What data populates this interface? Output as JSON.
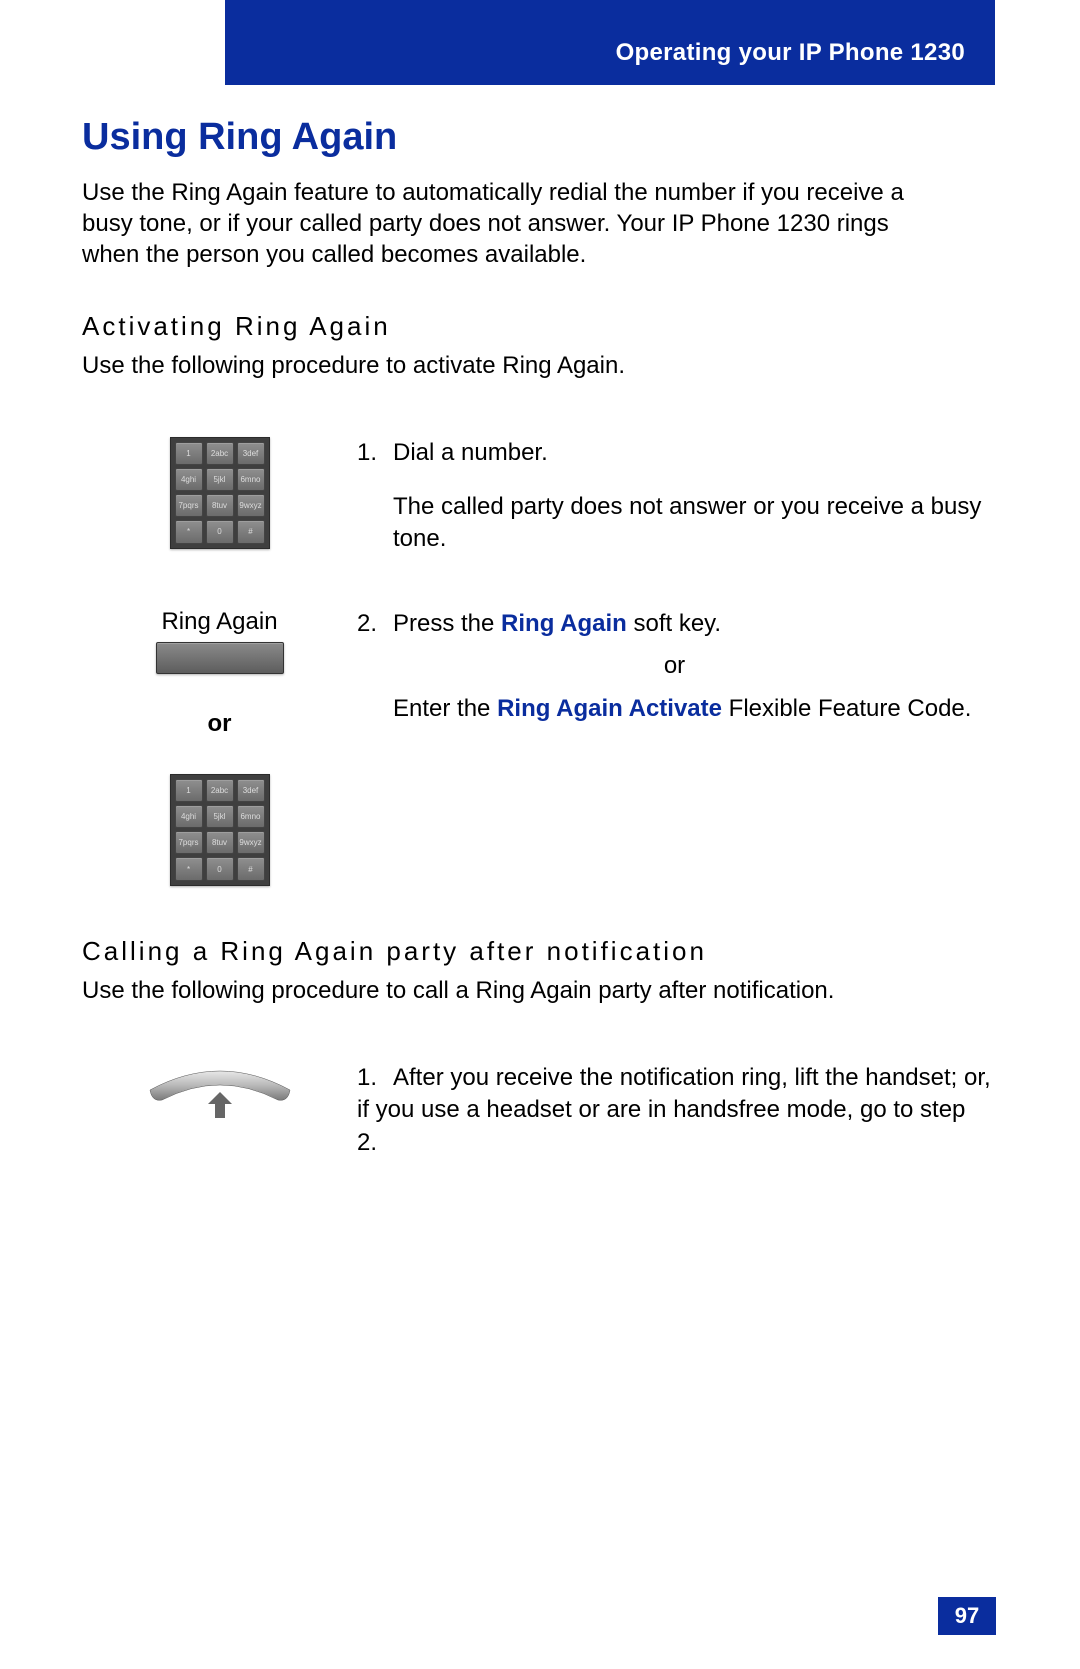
{
  "header": "Operating your IP Phone 1230",
  "h1": "Using Ring Again",
  "intro": "Use the Ring Again feature to automatically redial the number if you receive a busy tone, or if your called party does not answer. Your IP Phone 1230 rings when the person you called becomes available.",
  "section1": {
    "title": "Activating Ring Again",
    "intro": "Use the following procedure to activate Ring Again.",
    "step1": {
      "num": "1.",
      "text": "Dial a number.",
      "sub": "The called party does not answer or you receive a busy tone."
    },
    "step2": {
      "num": "2.",
      "softkey_label": "Ring Again",
      "prefix": "Press the ",
      "hl1": "Ring Again",
      "suffix1": " soft key.",
      "or": "or",
      "or_left": "or",
      "enter_prefix": "Enter the ",
      "hl2": "Ring Again Activate",
      "suffix2": " Flexible Feature Code."
    }
  },
  "section2": {
    "title": "Calling a Ring Again party after notification",
    "intro": "Use the following procedure to call a Ring Again party after notification.",
    "step1": {
      "num": "1.",
      "text": "After you receive the notification ring, lift the handset; or, if you use a headset or are in handsfree mode, go to step 2."
    }
  },
  "keypad": [
    "1",
    "2abc",
    "3def",
    "4ghi",
    "5jkl",
    "6mno",
    "7pqrs",
    "8tuv",
    "9wxyz",
    "*",
    "0",
    "#"
  ],
  "page": "97"
}
